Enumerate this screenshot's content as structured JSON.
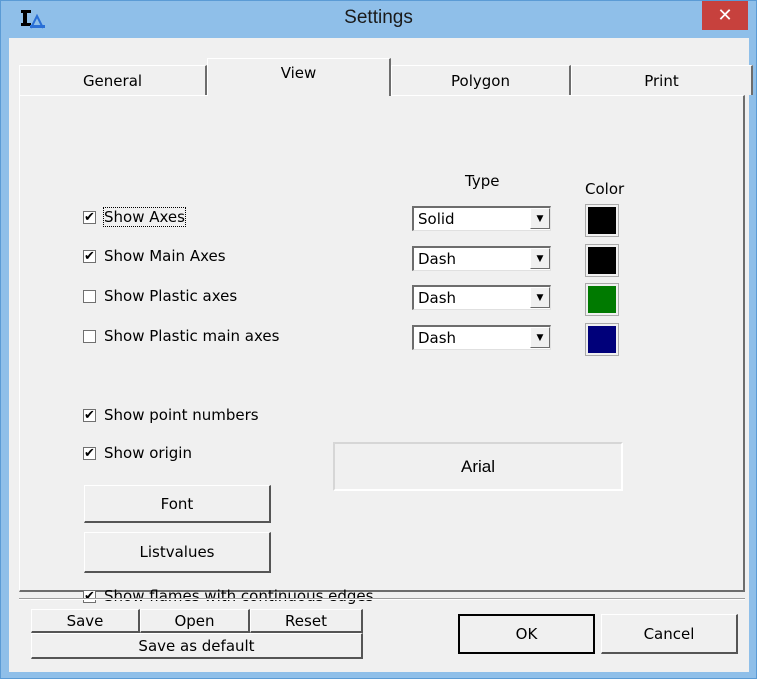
{
  "window": {
    "title": "Settings",
    "close_glyph": "✕",
    "app_icon": "ruler-compass-icon"
  },
  "tabs": [
    {
      "label": "General",
      "active": false
    },
    {
      "label": "View",
      "active": true
    },
    {
      "label": "Polygon",
      "active": false
    },
    {
      "label": "Print",
      "active": false
    }
  ],
  "columns": {
    "type_header": "Type",
    "color_header": "Color"
  },
  "axes_options": [
    {
      "label": "Show Axes",
      "checked": true,
      "type": "Solid",
      "color": "#000000"
    },
    {
      "label": "Show Main Axes",
      "checked": true,
      "type": "Dash",
      "color": "#000000"
    },
    {
      "label": "Show Plastic axes",
      "checked": false,
      "type": "Dash",
      "color": "#007a00"
    },
    {
      "label": "Show Plastic main axes",
      "checked": false,
      "type": "Dash",
      "color": "#00007a"
    }
  ],
  "display_options": {
    "show_point_numbers": {
      "label": "Show point numbers",
      "checked": true
    },
    "show_origin": {
      "label": "Show origin",
      "checked": true
    },
    "show_flames": {
      "label": "Show flames with continuous edges",
      "checked": true
    }
  },
  "buttons": {
    "font": "Font",
    "listvalues": "Listvalues",
    "save": "Save",
    "open": "Open",
    "reset": "Reset",
    "save_default": "Save as default",
    "ok": "OK",
    "cancel": "Cancel"
  },
  "font_display": "Arial",
  "check_glyph": "✔"
}
